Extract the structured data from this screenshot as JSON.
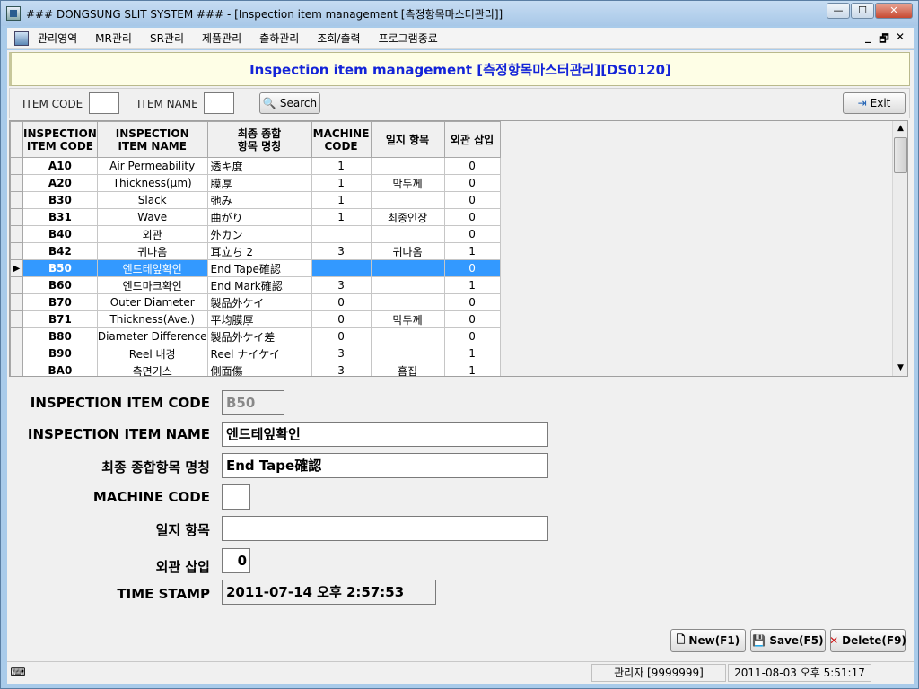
{
  "window": {
    "title": "### DONGSUNG SLIT SYSTEM ### - [Inspection item management [측정항목마스터관리]]",
    "controls": [
      "minimize-icon",
      "maximize-icon",
      "close-icon"
    ]
  },
  "menu": {
    "items": [
      "관리영역",
      "MR관리",
      "SR관리",
      "제품관리",
      "출하관리",
      "조회/출력",
      "프로그램종료"
    ],
    "mdi_controls": [
      "_",
      "🗗",
      "✕"
    ]
  },
  "header": {
    "title": "Inspection item management [측정항목마스터관리][DS0120]"
  },
  "search": {
    "item_code_label": "ITEM CODE",
    "item_code_value": "",
    "item_name_label": "ITEM NAME",
    "item_name_value": "",
    "search_label": "Search",
    "exit_label": "Exit"
  },
  "grid": {
    "columns": [
      "INSPECTION\nITEM CODE",
      "INSPECTION\nITEM NAME",
      "최종 종합\n항목 명칭",
      "MACHINE\nCODE",
      "일지 항목",
      "외관 삽입"
    ],
    "rows": [
      [
        "A10",
        "Air Permeability",
        "透キ度",
        "1",
        "",
        "0"
      ],
      [
        "A20",
        "Thickness(µm)",
        "膜厚",
        "1",
        "막두께",
        "0"
      ],
      [
        "B30",
        "Slack",
        "弛み",
        "1",
        "",
        "0"
      ],
      [
        "B31",
        "Wave",
        "曲がり",
        "1",
        "최종인장",
        "0"
      ],
      [
        "B40",
        "외관",
        "外カン",
        "",
        "",
        "0"
      ],
      [
        "B42",
        "귀나옴",
        "耳立ち 2",
        "3",
        "귀나옴",
        "1"
      ],
      [
        "B50",
        "엔드테잎확인",
        "End Tape確認",
        "",
        "",
        "0"
      ],
      [
        "B60",
        "엔드마크확인",
        "End Mark確認",
        "3",
        "",
        "1"
      ],
      [
        "B70",
        "Outer Diameter",
        "製品外ケイ",
        "0",
        "",
        "0"
      ],
      [
        "B71",
        "Thickness(Ave.)",
        "平均膜厚",
        "0",
        "막두께",
        "0"
      ],
      [
        "B80",
        "Diameter Difference",
        "製品外ケイ差",
        "0",
        "",
        "0"
      ],
      [
        "B90",
        "Reel 내경",
        "Reel ナイケイ",
        "3",
        "",
        "1"
      ],
      [
        "BA0",
        "측면기스",
        "側面傷",
        "3",
        "흠집",
        "1"
      ]
    ],
    "selected_index": 6,
    "selected_marker": "▶"
  },
  "detail": {
    "code_label": "INSPECTION ITEM CODE",
    "code_value": "B50",
    "name_label": "INSPECTION ITEM NAME",
    "name_value": "엔드테잎확인",
    "final_label": "최종 종합항목 명칭",
    "final_value": "End Tape確認",
    "machine_label": "MACHINE CODE",
    "machine_value": "",
    "journal_label": "일지 항목",
    "journal_value": "",
    "appearance_label": "외관 삽입",
    "appearance_value": "0",
    "timestamp_label": "TIME STAMP",
    "timestamp_value": "2011-07-14 오후 2:57:53"
  },
  "actions": {
    "new_label": "New(F1)",
    "save_label": "Save(F5)",
    "delete_label": "Delete(F9)"
  },
  "status": {
    "user": "관리자 [9999999]",
    "datetime": "2011-08-03 오후 5:51:17"
  }
}
